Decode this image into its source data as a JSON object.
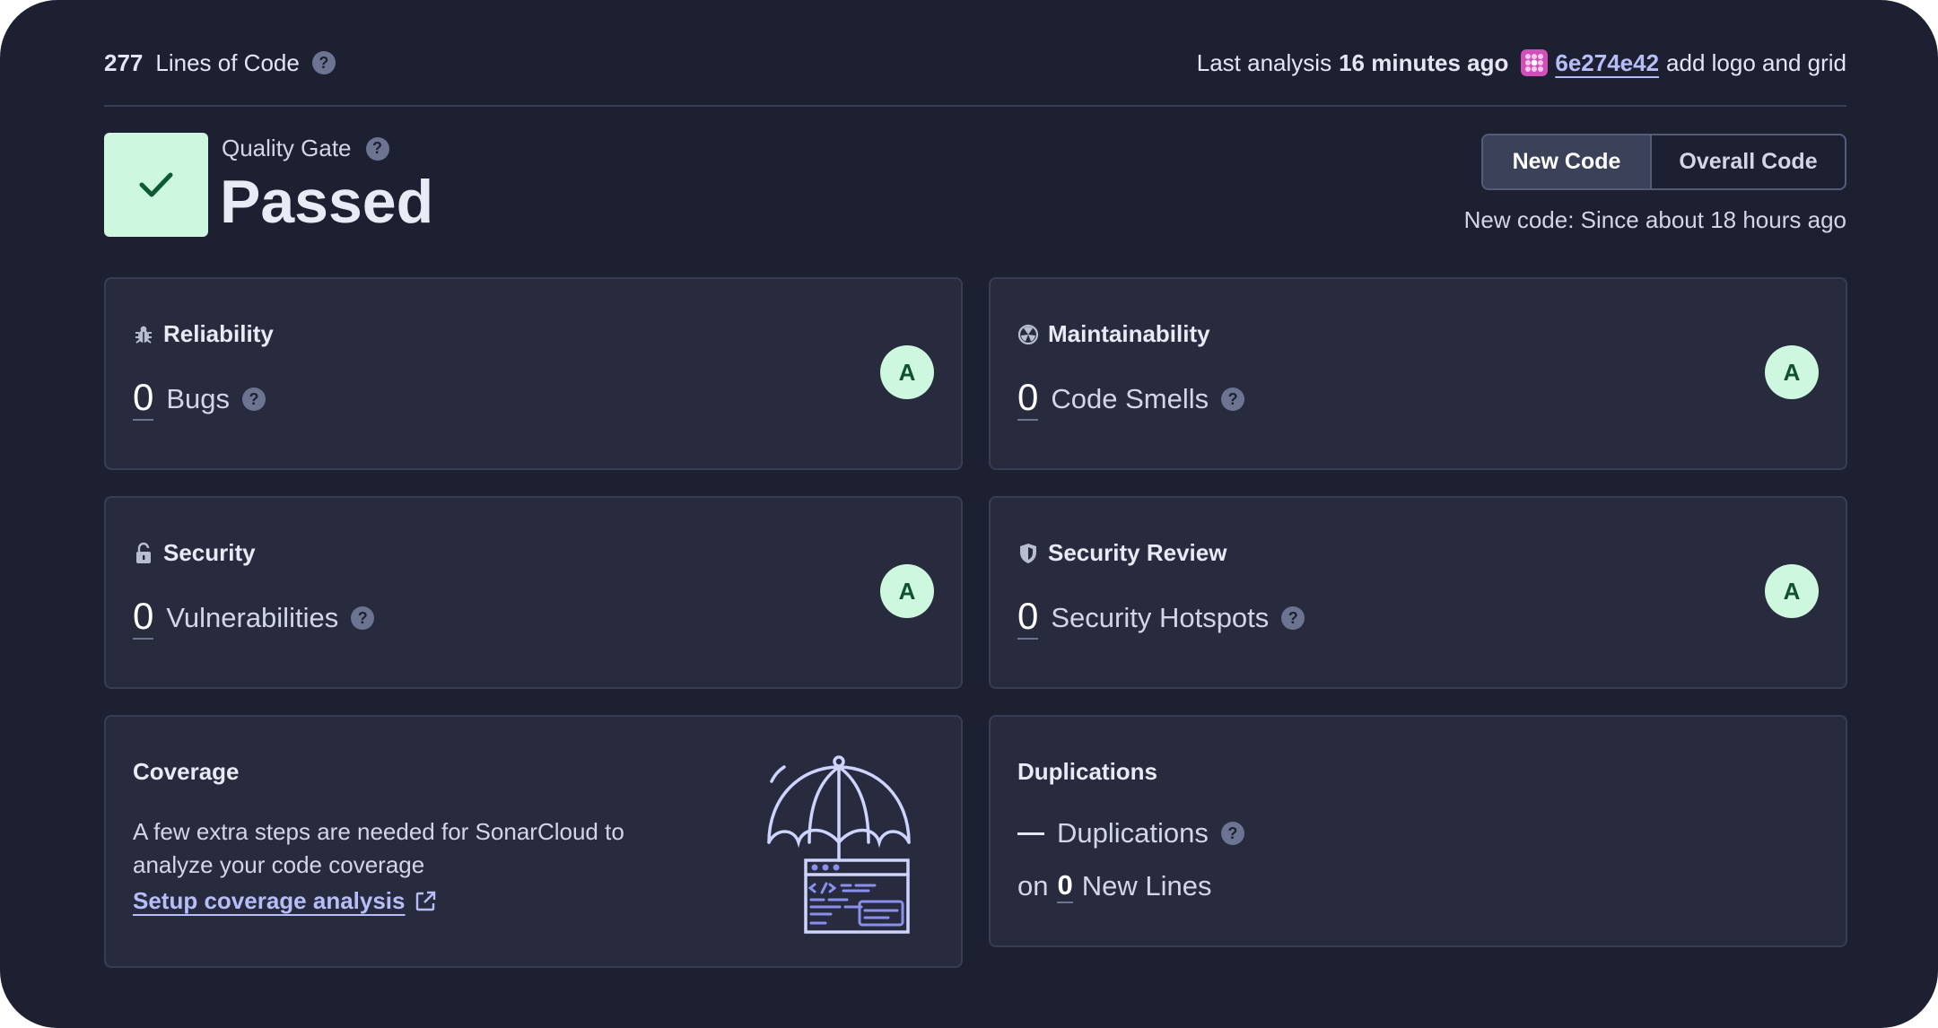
{
  "summary": {
    "lines_value": "277",
    "lines_label": "Lines of Code",
    "help": "?",
    "last_analysis_label": "Last analysis",
    "last_analysis_when": "16 minutes ago",
    "commit_hash": "6e274e42",
    "commit_message": "add logo and grid"
  },
  "quality_gate": {
    "label": "Quality Gate",
    "status": "Passed"
  },
  "toggle": {
    "new_code": "New Code",
    "overall_code": "Overall Code",
    "selected": "New Code"
  },
  "new_code_since": "New code: Since about 18 hours ago",
  "cards": {
    "reliability": {
      "title": "Reliability",
      "value": "0",
      "label": "Bugs",
      "rating": "A",
      "icon": "bug-icon"
    },
    "maintainability": {
      "title": "Maintainability",
      "value": "0",
      "label": "Code Smells",
      "rating": "A",
      "icon": "smell-icon"
    },
    "security": {
      "title": "Security",
      "value": "0",
      "label": "Vulnerabilities",
      "rating": "A",
      "icon": "unlock-icon"
    },
    "security_review": {
      "title": "Security Review",
      "value": "0",
      "label": "Security Hotspots",
      "rating": "A",
      "icon": "shield-icon"
    },
    "coverage": {
      "title": "Coverage",
      "text": "A few extra steps are needed for SonarCloud to analyze your code coverage",
      "link": "Setup coverage analysis",
      "icon": "external-link-icon"
    },
    "duplications": {
      "title": "Duplications",
      "label": "Duplications",
      "on": "on",
      "lines_value": "0",
      "lines_label": "New Lines"
    }
  },
  "colors": {
    "background": "#1d2031",
    "card": "#272b3d",
    "pass_green": "#cdf7de",
    "link": "#b7bdf8"
  }
}
